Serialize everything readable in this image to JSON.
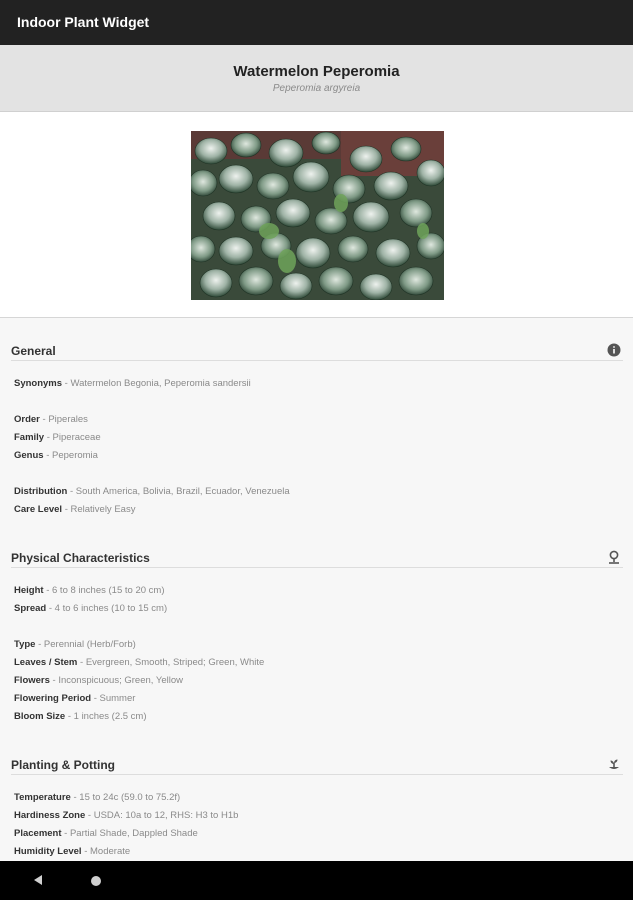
{
  "app": {
    "title": "Indoor Plant Widget"
  },
  "plant": {
    "name": "Watermelon Peperomia",
    "scientific": "Peperomia argyreia",
    "photo_alt": "Watermelon Peperomia leaves"
  },
  "sections": {
    "general": {
      "title": "General",
      "icon": "info-icon",
      "synonyms_k": "Synonyms",
      "synonyms_v": " - Watermelon Begonia, Peperomia sandersii",
      "order_k": "Order",
      "order_v": " - Piperales",
      "family_k": "Family",
      "family_v": " - Piperaceae",
      "genus_k": "Genus",
      "genus_v": " - Peperomia",
      "distribution_k": "Distribution",
      "distribution_v": " - South America, Bolivia, Brazil, Ecuador, Venezuela",
      "care_k": "Care Level",
      "care_v": " - Relatively Easy"
    },
    "physical": {
      "title": "Physical Characteristics",
      "icon": "plant-pin-icon",
      "height_k": "Height",
      "height_v": " - 6 to 8 inches (15 to 20 cm)",
      "spread_k": "Spread",
      "spread_v": " - 4 to 6 inches (10 to 15 cm)",
      "type_k": "Type",
      "type_v": " - Perennial (Herb/Forb)",
      "leaves_k": "Leaves / Stem",
      "leaves_v": " - Evergreen, Smooth, Striped; Green, White",
      "flowers_k": "Flowers",
      "flowers_v": " - Inconspicuous; Green, Yellow",
      "flowering_k": "Flowering Period",
      "flowering_v": " - Summer",
      "bloom_k": "Bloom Size",
      "bloom_v": " - 1 inches (2.5 cm)"
    },
    "planting": {
      "title": "Planting & Potting",
      "icon": "sprout-icon",
      "temp_k": "Temperature",
      "temp_v": " - 15 to 24c (59.0 to 75.2f)",
      "hardiness_k": "Hardiness Zone",
      "hardiness_v": " - USDA: 10a to 12, RHS: H3 to H1b",
      "placement_k": "Placement",
      "placement_v": " - Partial Shade, Dappled Shade",
      "humidity_k": "Humidity Level",
      "humidity_v": " - Moderate"
    }
  },
  "colors": {
    "appbar": "#222222",
    "header_bg": "#e3e3e3",
    "content_bg": "#f7f7f7",
    "label": "#333333",
    "value": "#8a8a8a"
  }
}
